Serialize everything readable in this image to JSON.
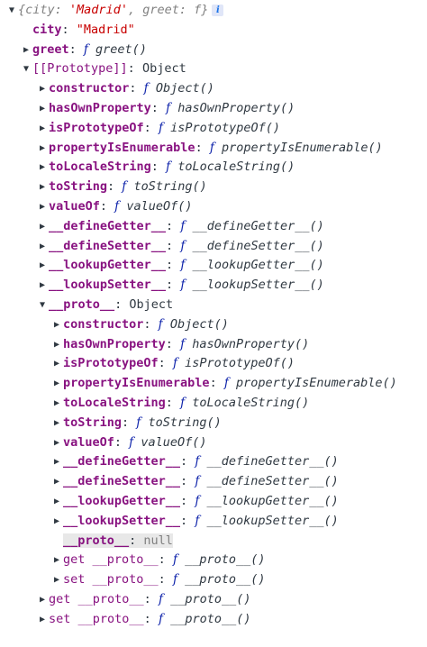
{
  "root": {
    "summary_open": "{",
    "summary_key1": "city",
    "summary_val1": "'Madrid'",
    "summary_sep": ", ",
    "summary_key2": "greet",
    "summary_val2": "f",
    "summary_close": "}",
    "info_icon_text": "i"
  },
  "city_row": {
    "key": "city",
    "value": "\"Madrid\""
  },
  "greet_row": {
    "key": "greet",
    "f": "f",
    "value": "greet()"
  },
  "proto1": {
    "key": "[[Prototype]]",
    "value": "Object"
  },
  "proto1_items": [
    {
      "key": "constructor",
      "f": "f",
      "value": "Object()"
    },
    {
      "key": "hasOwnProperty",
      "f": "f",
      "value": "hasOwnProperty()"
    },
    {
      "key": "isPrototypeOf",
      "f": "f",
      "value": "isPrototypeOf()"
    },
    {
      "key": "propertyIsEnumerable",
      "f": "f",
      "value": "propertyIsEnumerable()"
    },
    {
      "key": "toLocaleString",
      "f": "f",
      "value": "toLocaleString()"
    },
    {
      "key": "toString",
      "f": "f",
      "value": "toString()"
    },
    {
      "key": "valueOf",
      "f": "f",
      "value": "valueOf()"
    },
    {
      "key": "__defineGetter__",
      "f": "f",
      "value": "__defineGetter__()"
    },
    {
      "key": "__defineSetter__",
      "f": "f",
      "value": "__defineSetter__()"
    },
    {
      "key": "__lookupGetter__",
      "f": "f",
      "value": "__lookupGetter__()"
    },
    {
      "key": "__lookupSetter__",
      "f": "f",
      "value": "__lookupSetter__()"
    }
  ],
  "proto2": {
    "key": "__proto__",
    "value": "Object"
  },
  "proto2_items": [
    {
      "key": "constructor",
      "f": "f",
      "value": "Object()"
    },
    {
      "key": "hasOwnProperty",
      "f": "f",
      "value": "hasOwnProperty()"
    },
    {
      "key": "isPrototypeOf",
      "f": "f",
      "value": "isPrototypeOf()"
    },
    {
      "key": "propertyIsEnumerable",
      "f": "f",
      "value": "propertyIsEnumerable()"
    },
    {
      "key": "toLocaleString",
      "f": "f",
      "value": "toLocaleString()"
    },
    {
      "key": "toString",
      "f": "f",
      "value": "toString()"
    },
    {
      "key": "valueOf",
      "f": "f",
      "value": "valueOf()"
    },
    {
      "key": "__defineGetter__",
      "f": "f",
      "value": "__defineGetter__()"
    },
    {
      "key": "__defineSetter__",
      "f": "f",
      "value": "__defineSetter__()"
    },
    {
      "key": "__lookupGetter__",
      "f": "f",
      "value": "__lookupGetter__()"
    },
    {
      "key": "__lookupSetter__",
      "f": "f",
      "value": "__lookupSetter__()"
    }
  ],
  "proto2_null": {
    "key": "__proto__",
    "value": "null"
  },
  "proto2_get": {
    "prefix": "get ",
    "key": "__proto__",
    "f": "f",
    "value": "__proto__()"
  },
  "proto2_set": {
    "prefix": "set ",
    "key": "__proto__",
    "f": "f",
    "value": "__proto__()"
  },
  "proto1_get": {
    "prefix": "get ",
    "key": "__proto__",
    "f": "f",
    "value": "__proto__()"
  },
  "proto1_set": {
    "prefix": "set ",
    "key": "__proto__",
    "f": "f",
    "value": "__proto__()"
  },
  "colors": {
    "key": "#881280",
    "string": "#c80000",
    "f_symbol": "#0d22aa",
    "null": "#808080"
  },
  "icons": {
    "expanded": "triangle-down-icon",
    "collapsed": "triangle-right-icon"
  }
}
